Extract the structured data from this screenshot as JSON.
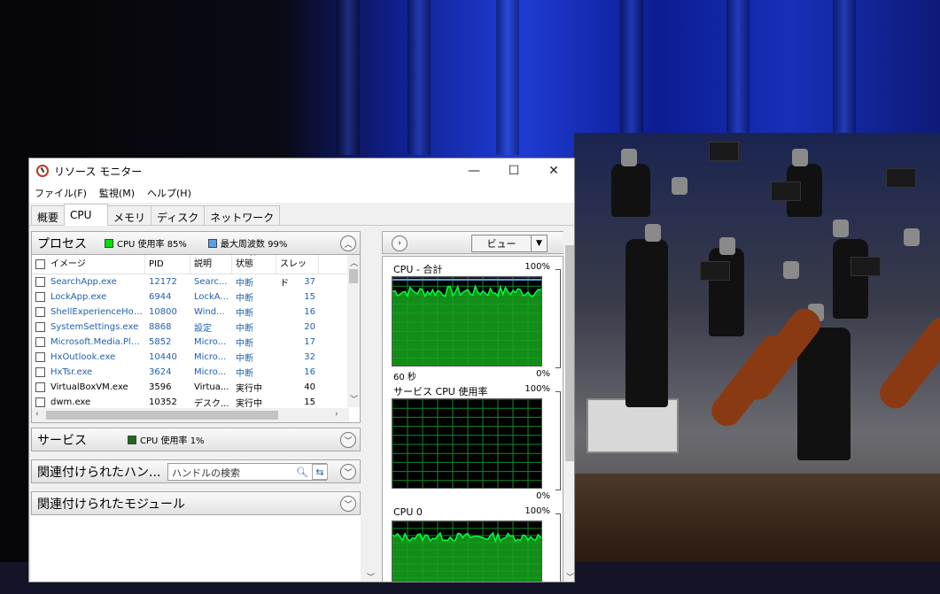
{
  "window": {
    "title": "リソース モニター",
    "controls": {
      "minimize": "—",
      "maximize": "☐",
      "close": "✕"
    }
  },
  "menu": [
    "ファイル(F)",
    "監視(M)",
    "ヘルプ(H)"
  ],
  "tabs": [
    "概要",
    "CPU",
    "メモリ",
    "ディスク",
    "ネットワーク"
  ],
  "active_tab": "CPU",
  "process_panel": {
    "title": "プロセス",
    "cpu_usage": "CPU 使用率 85%",
    "max_freq": "最大周波数 99%",
    "columns": [
      "イメージ",
      "PID",
      "説明",
      "状態",
      "スレッド"
    ],
    "rows": [
      {
        "image": "SearchApp.exe",
        "pid": "12172",
        "desc": "Searc...",
        "status": "中断",
        "threads": "37",
        "suspended": true
      },
      {
        "image": "LockApp.exe",
        "pid": "6944",
        "desc": "LockA...",
        "status": "中断",
        "threads": "15",
        "suspended": true
      },
      {
        "image": "ShellExperienceHost...",
        "pid": "10800",
        "desc": "Wind...",
        "status": "中断",
        "threads": "16",
        "suspended": true
      },
      {
        "image": "SystemSettings.exe",
        "pid": "8868",
        "desc": "設定",
        "status": "中断",
        "threads": "20",
        "suspended": true
      },
      {
        "image": "Microsoft.Media.Play...",
        "pid": "5852",
        "desc": "Micro...",
        "status": "中断",
        "threads": "17",
        "suspended": true
      },
      {
        "image": "HxOutlook.exe",
        "pid": "10440",
        "desc": "Micro...",
        "status": "中断",
        "threads": "32",
        "suspended": true
      },
      {
        "image": "HxTsr.exe",
        "pid": "3624",
        "desc": "Micro...",
        "status": "中断",
        "threads": "16",
        "suspended": true
      },
      {
        "image": "VirtualBoxVM.exe",
        "pid": "3596",
        "desc": "Virtua...",
        "status": "実行中",
        "threads": "40",
        "suspended": false
      },
      {
        "image": "dwm.exe",
        "pid": "10352",
        "desc": "デスク...",
        "status": "実行中",
        "threads": "15",
        "suspended": false
      }
    ]
  },
  "services_panel": {
    "title": "サービス",
    "cpu_usage": "CPU 使用率 1%"
  },
  "handles_panel": {
    "title": "関連付けられたハン...",
    "search_placeholder": "ハンドルの検索"
  },
  "modules_panel": {
    "title": "関連付けられたモジュール"
  },
  "right_panel": {
    "view_label": "ビュー",
    "graphs": [
      {
        "title": "CPU - 合計",
        "max": "100%",
        "time": "60 秒",
        "min": "0%"
      },
      {
        "title": "サービス CPU 使用率",
        "max": "100%",
        "min": "0%"
      },
      {
        "title": "CPU 0",
        "max": "100%"
      }
    ]
  },
  "colors": {
    "cpu_legend": "#00e000",
    "freq_legend": "#5aa0e6",
    "svc_legend": "#1a6a1a",
    "graph_fill": "#16a41c",
    "graph_line": "#00ff40",
    "graph_grid": "#128a2a"
  }
}
